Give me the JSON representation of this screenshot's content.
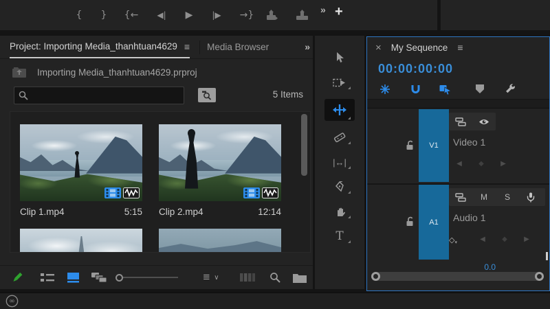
{
  "colors": {
    "accent_blue": "#2d8ceb",
    "timecode_blue": "#3a8ed8",
    "patch_blue": "#17699a",
    "panel_border_blue": "#2f76c2",
    "pencil_green": "#2fa32f"
  },
  "top_toolbar": {
    "mark_in": "{",
    "mark_out": "}",
    "go_to_in": "{←",
    "step_back": "◀|",
    "play": "▶",
    "step_forward": "|▶",
    "go_to_out": "→}",
    "overflow": "»",
    "add_button": "+"
  },
  "project_panel": {
    "project_tab": "Project: Importing Media_thanhtuan4629",
    "panel_menu": "≡",
    "media_browser_tab": "Media Browser",
    "overflow": "»",
    "breadcrumb": "Importing Media_thanhtuan4629.prproj",
    "search_value": "",
    "items_count": "5 Items",
    "clips": [
      {
        "name": "Clip 1.mp4",
        "duration": "5:15"
      },
      {
        "name": "Clip 2.mp4",
        "duration": "12:14"
      }
    ],
    "sort_icon": "≡",
    "sort_caret": "∨"
  },
  "tools": {
    "slip": "|↔|",
    "type": "T"
  },
  "timeline": {
    "close": "×",
    "title": "My Sequence",
    "panel_menu": "≡",
    "timecode": "00:00:00:00",
    "video_track": {
      "patch": "V1",
      "label": "Video 1"
    },
    "audio_track": {
      "patch": "A1",
      "label": "Audio 1",
      "mute": "M",
      "solo": "S"
    },
    "audio_gain": "0.0",
    "kf_prev": "◀",
    "kf_add": "◆",
    "kf_next": "▶",
    "audio_kf": "◇",
    "audio_kf_caret": "▾"
  }
}
